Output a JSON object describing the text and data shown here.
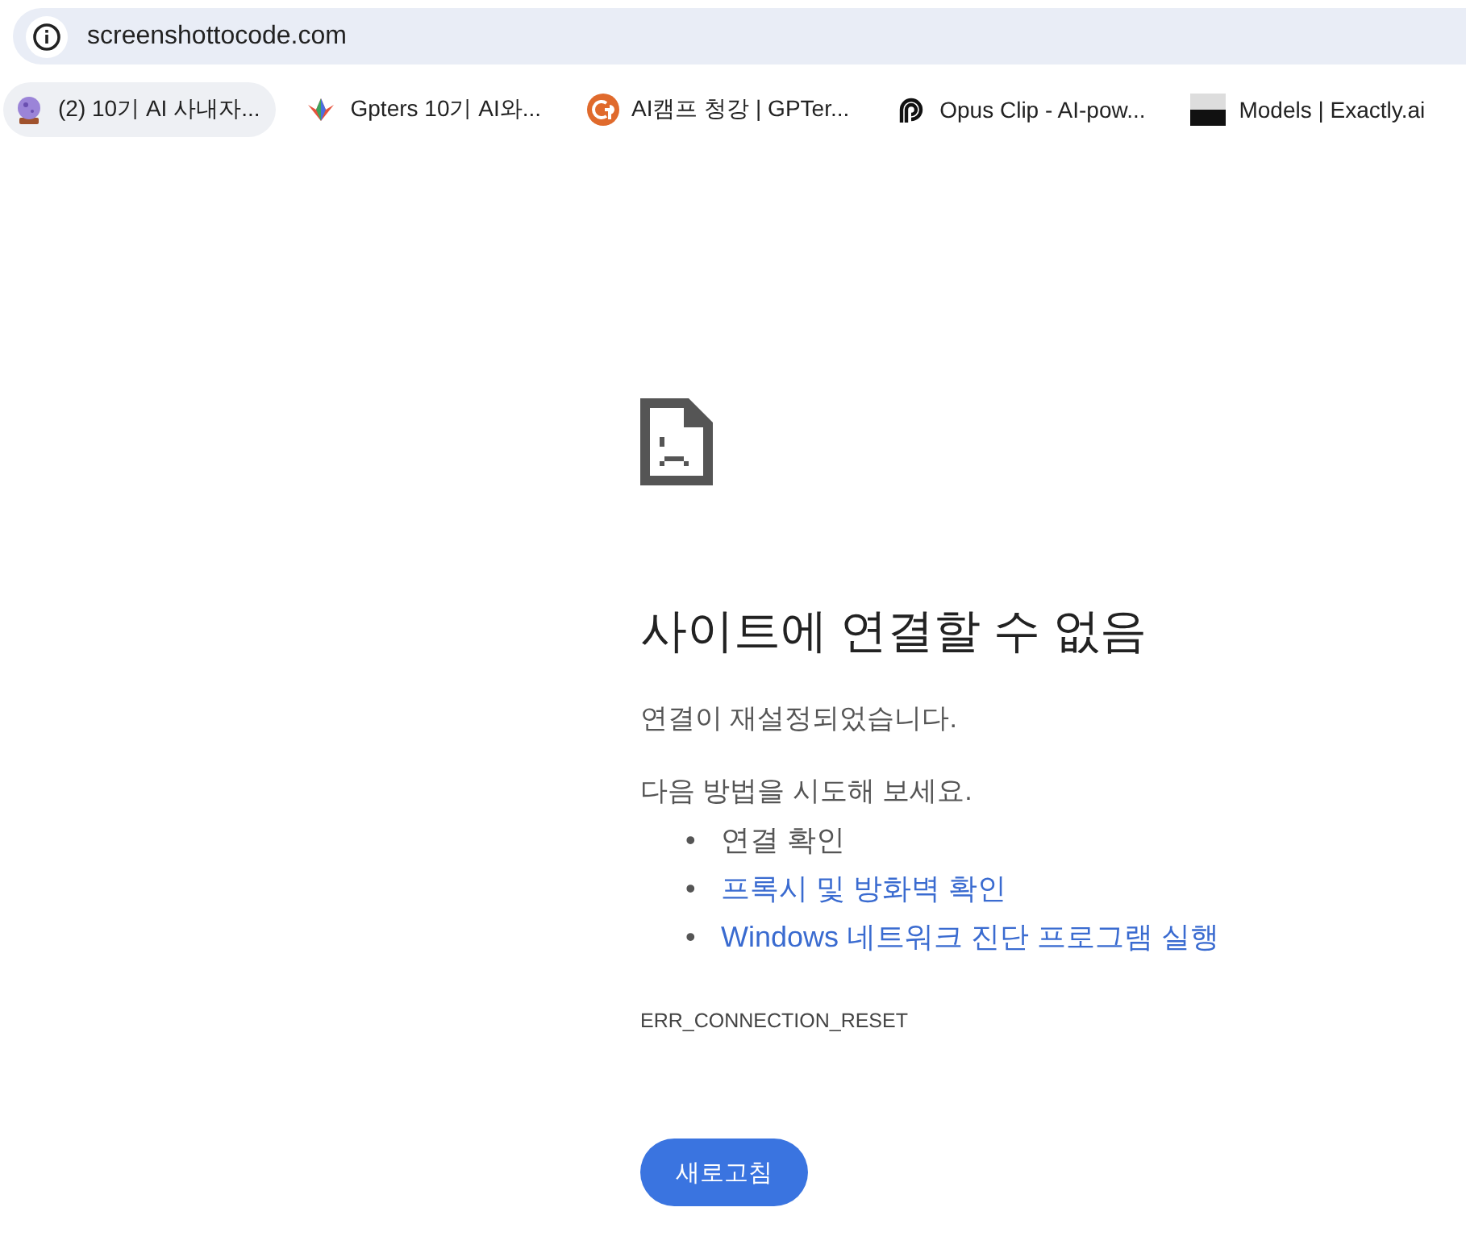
{
  "address_bar": {
    "url": "screenshottocode.com"
  },
  "bookmarks": [
    {
      "label": "(2) 10기 AI 사내자...",
      "selected": true
    },
    {
      "label": "Gpters 10기 AI와...",
      "selected": false
    },
    {
      "label": "AI캠프 청강 | GPTer...",
      "selected": false
    },
    {
      "label": "Opus Clip - AI-pow...",
      "selected": false
    },
    {
      "label": "Models | Exactly.ai",
      "selected": false
    }
  ],
  "error": {
    "title": "사이트에 연결할 수 없음",
    "message": "연결이 재설정되었습니다.",
    "suggestions_intro": "다음 방법을 시도해 보세요.",
    "suggestions": [
      {
        "kind": "text",
        "marker": "•",
        "text": "연결 확인"
      },
      {
        "kind": "link",
        "marker": "•",
        "text": "프록시 및 방화벽 확인"
      },
      {
        "kind": "link",
        "marker": "•",
        "text": "Windows 네트워크 진단 프로그램 실행"
      }
    ],
    "code": "ERR_CONNECTION_RESET",
    "button": "새로고침"
  }
}
